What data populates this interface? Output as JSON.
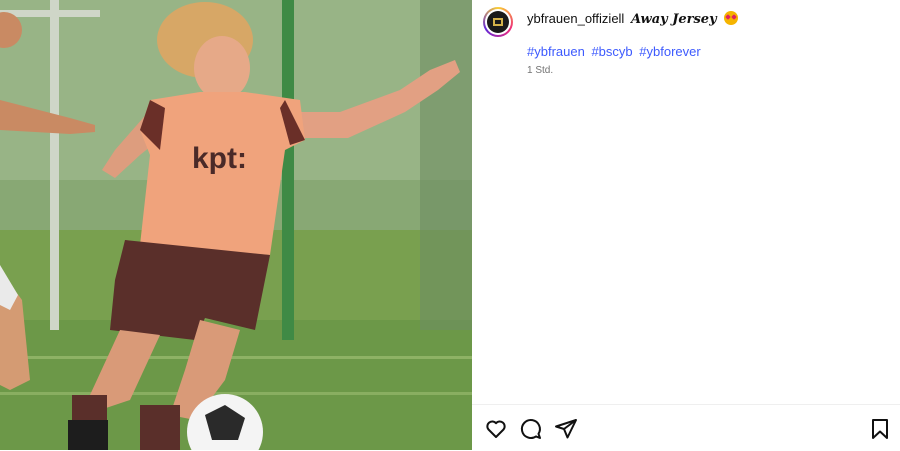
{
  "post": {
    "image": {
      "alt": ""
    },
    "author": {
      "username": "ybfrauen_offiziell",
      "avatar_icon": "club-logo-icon"
    },
    "caption": {
      "title": "Away Jersey",
      "emoji": "heart-eyes-emoji"
    },
    "hashtags": [
      "#ybfrauen",
      "#bscyb",
      "#ybforever"
    ],
    "timestamp": "1 Std."
  },
  "actions": {
    "like_icon": "heart-icon",
    "comment_icon": "comment-icon",
    "share_icon": "share-icon",
    "save_icon": "bookmark-icon"
  },
  "colors": {
    "hashtag": "#3d5afe",
    "jersey": "#f0a37c",
    "shorts": "#5a2f2a",
    "field": "#6f9a4a"
  }
}
